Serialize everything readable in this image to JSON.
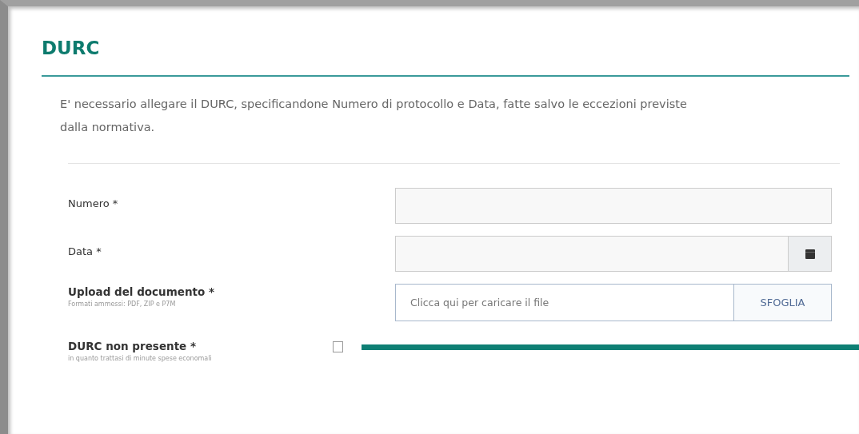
{
  "section": {
    "title": "DURC",
    "description": "E' necessario allegare il DURC, specificandone Numero di protocollo e Data, fatte salvo le eccezioni previste dalla normativa."
  },
  "fields": [
    {
      "kind": "text",
      "label": "Numero *"
    },
    {
      "kind": "date",
      "label": "Data *"
    },
    {
      "kind": "file",
      "label": "Upload del documento *",
      "hint": "Formati ammessi: PDF, ZIP e P7M",
      "placeholder": "Clicca qui per caricare il file",
      "button": "SFOGLIA"
    },
    {
      "kind": "checkbox",
      "label": "DURC non presente *",
      "hint": "in quanto trattasi di minute spese economali",
      "checked": false
    }
  ]
}
